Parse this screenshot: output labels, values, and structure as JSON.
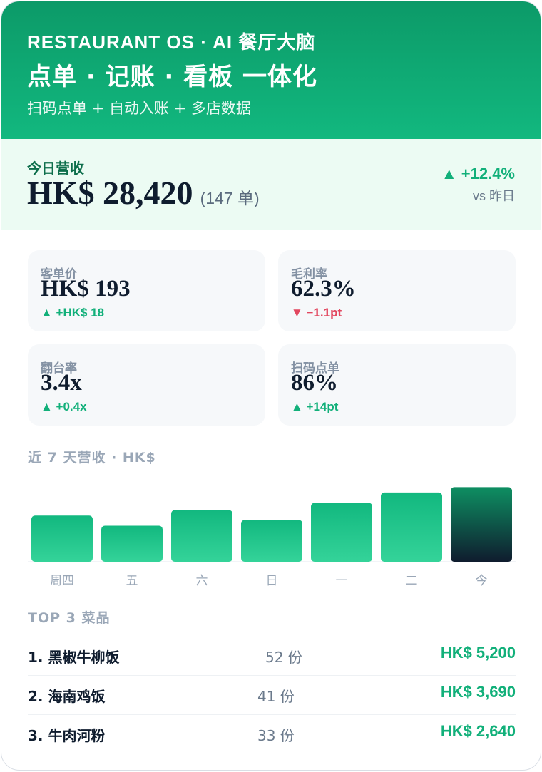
{
  "header": {
    "eyebrow": "RESTAURANT OS · AI 餐厅大脑",
    "headline": "点单 · 记账 · 看板 一体化",
    "tagline": "扫码点单 + 自动入账 + 多店数据"
  },
  "today": {
    "label": "今日营收",
    "amount": "HK$ 28,420",
    "orders": "(147 单)",
    "change": "▲ +12.4%",
    "compare": "vs 昨日"
  },
  "metrics": [
    {
      "label": "客单价",
      "value": "HK$ 193",
      "delta": "▲ +HK$ 18",
      "trend": "up"
    },
    {
      "label": "毛利率",
      "value": "62.3%",
      "delta": "▼ −1.1pt",
      "trend": "down"
    },
    {
      "label": "翻台率",
      "value": "3.4x",
      "delta": "▲ +0.4x",
      "trend": "up"
    },
    {
      "label": "扫码点单",
      "value": "86%",
      "delta": "▲ +14pt",
      "trend": "up"
    }
  ],
  "chart_title": "近 7 天营收 · HK$",
  "chart_data": {
    "type": "bar",
    "categories": [
      "周四",
      "五",
      "六",
      "日",
      "一",
      "二",
      "今"
    ],
    "values": [
      23200,
      18100,
      26000,
      21000,
      29600,
      34800,
      37500
    ],
    "ylim": [
      0,
      38000
    ],
    "highlight_index": 6,
    "grid": false,
    "colors": {
      "bar": "#12b87f",
      "bar_light": "#34d399",
      "highlight_top": "#0e8f62",
      "highlight_bottom": "#0f1c2e"
    }
  },
  "top_title": "TOP 3 菜品",
  "dishes": [
    {
      "name": "1. 黑椒牛柳饭",
      "qty": "52 份",
      "revenue": "HK$ 5,200"
    },
    {
      "name": "2. 海南鸡饭",
      "qty": "41 份",
      "revenue": "HK$ 3,690"
    },
    {
      "name": "3. 牛肉河粉",
      "qty": "33 份",
      "revenue": "HK$ 2,640"
    }
  ]
}
